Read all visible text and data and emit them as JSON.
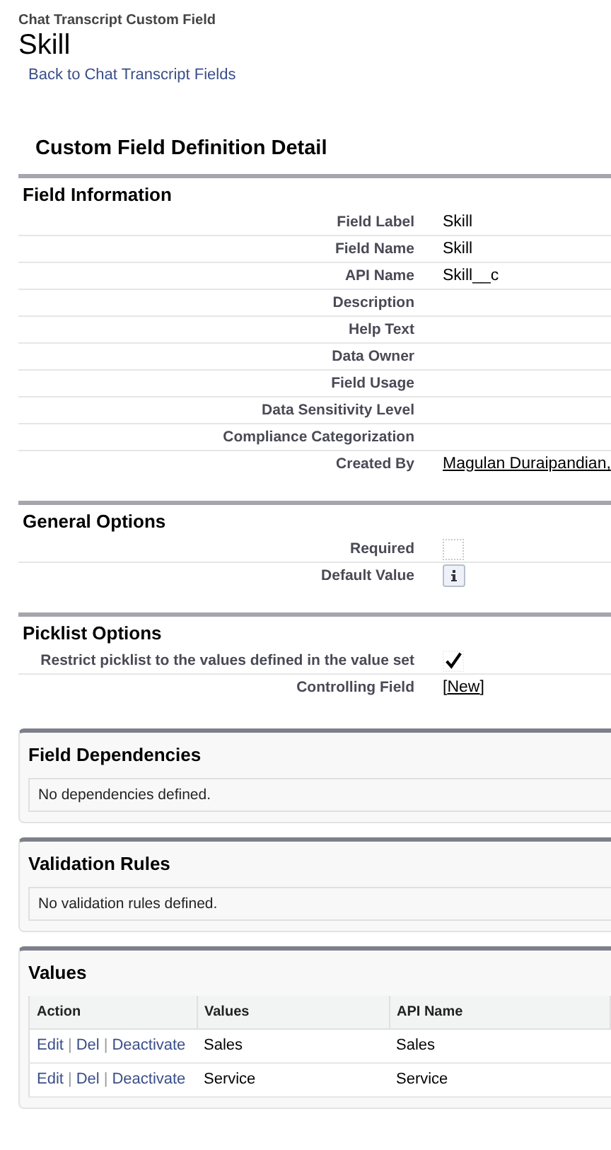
{
  "breadcrumb": "Chat Transcript Custom Field",
  "title": "Skill",
  "back_link": "Back to Chat Transcript Fields",
  "detail_title": "Custom Field Definition Detail",
  "sections": [
    {
      "title": "Field Information",
      "rows": [
        {
          "label": "Field Label",
          "kind": "text",
          "value": "Skill"
        },
        {
          "label": "Field Name",
          "kind": "text",
          "value": "Skill"
        },
        {
          "label": "API Name",
          "kind": "text",
          "value": "Skill__c"
        },
        {
          "label": "Description",
          "kind": "empty"
        },
        {
          "label": "Help Text",
          "kind": "empty"
        },
        {
          "label": "Data Owner",
          "kind": "empty"
        },
        {
          "label": "Field Usage",
          "kind": "empty"
        },
        {
          "label": "Data Sensitivity Level",
          "kind": "empty"
        },
        {
          "label": "Compliance Categorization",
          "kind": "empty"
        },
        {
          "label": "Created By",
          "kind": "link",
          "value": "Magulan Duraipandian,"
        }
      ]
    },
    {
      "title": "General Options",
      "rows": [
        {
          "label": "Required",
          "kind": "checkbox",
          "checked": false
        },
        {
          "label": "Default Value",
          "kind": "info"
        }
      ]
    },
    {
      "title": "Picklist Options",
      "rows": [
        {
          "label": "Restrict picklist to the values defined in the value set",
          "kind": "checkbox",
          "checked": true
        },
        {
          "label": "Controlling Field",
          "kind": "bracket_link",
          "before": "[",
          "value": "New",
          "after": "]"
        }
      ]
    }
  ],
  "related_lists": [
    {
      "title": "Field Dependencies",
      "kind": "message",
      "message": "No dependencies defined."
    },
    {
      "title": "Validation Rules",
      "kind": "message",
      "message": "No validation rules defined."
    },
    {
      "title": "Values",
      "kind": "table",
      "columns": [
        "Action",
        "Values",
        "API Name"
      ],
      "action_separator": "|",
      "rows": [
        {
          "cells": [
            [
              "Edit",
              "Del",
              "Deactivate"
            ],
            "Sales",
            "Sales"
          ]
        },
        {
          "cells": [
            [
              "Edit",
              "Del",
              "Deactivate"
            ],
            "Service",
            "Service"
          ]
        }
      ]
    }
  ]
}
